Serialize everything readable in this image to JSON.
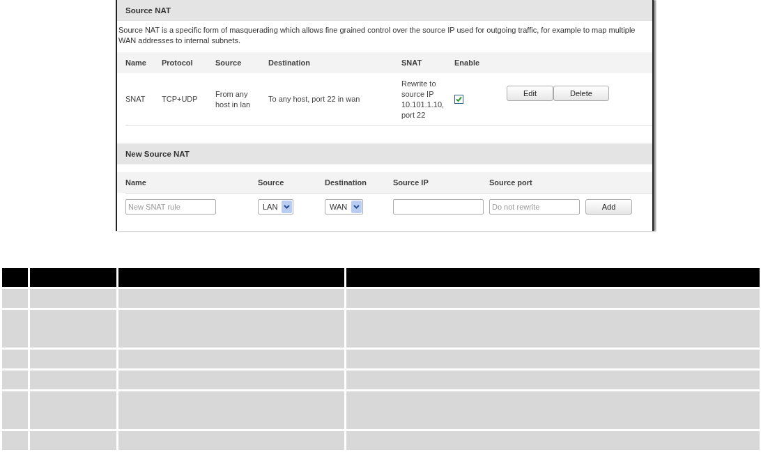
{
  "source_nat": {
    "title": "Source NAT",
    "description": "Source NAT is a specific form of masquerading which allows fine grained control over the source IP used for outgoing traffic, for example to map multiple WAN addresses to internal subnets.",
    "columns": [
      "Name",
      "Protocol",
      "Source",
      "Destination",
      "SNAT",
      "Enable"
    ],
    "rows": [
      {
        "name": "SNAT",
        "protocol": "TCP+UDP",
        "source": "From any host in lan",
        "destination": "To any host, port 22 in wan",
        "snat": "Rewrite to source IP 10.101.1.10, port 22",
        "enabled": true,
        "buttons": [
          "Edit",
          "Delete"
        ]
      }
    ]
  },
  "new_source_nat": {
    "title": "New Source NAT",
    "columns": [
      "Name",
      "Source",
      "Destination",
      "Source IP",
      "Source port"
    ],
    "name_placeholder": "New SNAT rule",
    "source_value": "LAN",
    "destination_value": "WAN",
    "source_port_placeholder": "Do not rewrite",
    "add_button": "Add"
  },
  "blank_table": {
    "rows": [
      {
        "tall": false
      },
      {
        "tall": true
      },
      {
        "tall": false
      },
      {
        "tall": false
      },
      {
        "tall": true
      },
      {
        "tall": false
      }
    ]
  }
}
